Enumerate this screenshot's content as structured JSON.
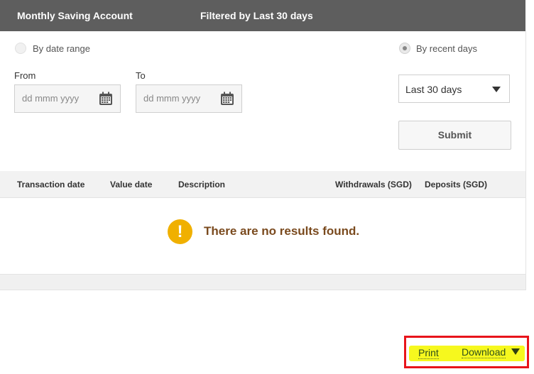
{
  "header": {
    "account_title": "Monthly Saving Account",
    "filter_text": "Filtered by Last 30 days"
  },
  "filters": {
    "radio_date_range": {
      "label": "By date range",
      "selected": false
    },
    "radio_recent_days": {
      "label": "By recent days",
      "selected": true
    },
    "from": {
      "label": "From",
      "placeholder": "dd mmm yyyy",
      "value": ""
    },
    "to": {
      "label": "To",
      "placeholder": "dd mmm yyyy",
      "value": ""
    },
    "recent_days_select": {
      "value": "Last 30 days"
    },
    "submit_label": "Submit"
  },
  "table": {
    "columns": [
      "Transaction date",
      "Value date",
      "Description",
      "Withdrawals (SGD)",
      "Deposits (SGD)"
    ],
    "rows": [],
    "empty_message": "There are no results found.",
    "empty_icon": "!"
  },
  "actions": {
    "print_label": "Print",
    "download_label": "Download"
  },
  "colors": {
    "header_bg": "#5e5e5e",
    "warning_icon": "#f0b000",
    "empty_text": "#7a4a1e",
    "highlight": "#f6f81e",
    "annotation_box": "#e8141b"
  }
}
